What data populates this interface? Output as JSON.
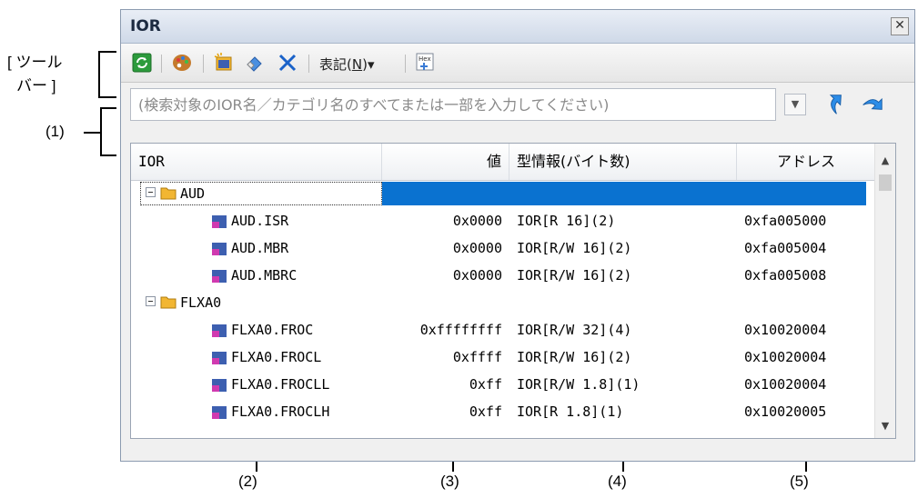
{
  "window": {
    "title": "IOR"
  },
  "toolbar": {
    "notation_label": "表記(",
    "notation_key": "N",
    "notation_tail": ")▾"
  },
  "search": {
    "placeholder": "(検索対象のIOR名／カテゴリ名のすべてまたは一部を入力してください)"
  },
  "table": {
    "headers": {
      "name": "IOR",
      "value": "値",
      "type": "型情報(バイト数)",
      "address": "アドレス"
    },
    "categories": [
      {
        "name": "AUD",
        "items": [
          {
            "name": "AUD.ISR",
            "value": "0x0000",
            "type": "IOR[R 16](2)",
            "address": "0xfa005000"
          },
          {
            "name": "AUD.MBR",
            "value": "0x0000",
            "type": "IOR[R/W 16](2)",
            "address": "0xfa005004"
          },
          {
            "name": "AUD.MBRC",
            "value": "0x0000",
            "type": "IOR[R/W 16](2)",
            "address": "0xfa005008"
          }
        ]
      },
      {
        "name": "FLXA0",
        "items": [
          {
            "name": "FLXA0.FROC",
            "value": "0xffffffff",
            "type": "IOR[R/W 32](4)",
            "address": "0x10020004"
          },
          {
            "name": "FLXA0.FROCL",
            "value": "0xffff",
            "type": "IOR[R/W 16](2)",
            "address": "0x10020004"
          },
          {
            "name": "FLXA0.FROCLL",
            "value": "0xff",
            "type": "IOR[R/W 1.8](1)",
            "address": "0x10020004"
          },
          {
            "name": "FLXA0.FROCLH",
            "value": "0xff",
            "type": "IOR[R 1.8](1)",
            "address": "0x10020005"
          }
        ]
      }
    ]
  },
  "annotations": {
    "toolbar_line1": "[ ツール",
    "toolbar_line2": "バー ]",
    "label1": "(1)",
    "label2": "(2)",
    "label3": "(3)",
    "label4": "(4)",
    "label5": "(5)"
  },
  "colors": {
    "selection": "#0a72d0",
    "category_icon": "#f2b632",
    "item_icon": "#3d5fb0"
  },
  "icons": {
    "refresh": "refresh-icon",
    "palette": "palette-icon",
    "new_folder": "new-category-icon",
    "eraser": "eraser-icon",
    "delete": "delete-icon",
    "hex": "hex-icon",
    "search_up": "search-up-icon",
    "search_down": "search-down-icon"
  }
}
